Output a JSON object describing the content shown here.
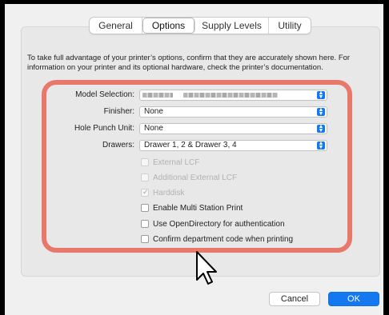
{
  "tabs": [
    {
      "label": "General"
    },
    {
      "label": "Options",
      "selected": true
    },
    {
      "label": "Supply Levels"
    },
    {
      "label": "Utility"
    }
  ],
  "intro_text": "To take full advantage of your printer’s options, confirm that they are accurately shown here. For information on your printer and its optional hardware, check the printer’s documentation.",
  "settings": {
    "model": {
      "label": "Model Selection:",
      "value": ""
    },
    "finisher": {
      "label": "Finisher:",
      "value": "None"
    },
    "hole_punch": {
      "label": "Hole Punch Unit:",
      "value": "None"
    },
    "drawers": {
      "label": "Drawers:",
      "value": "Drawer 1, 2 & Drawer 3, 4"
    }
  },
  "options": [
    {
      "label": "External LCF",
      "checked": false,
      "enabled": false
    },
    {
      "label": "Additional External LCF",
      "checked": false,
      "enabled": false
    },
    {
      "label": "Harddisk",
      "checked": true,
      "enabled": false
    },
    {
      "label": "Enable Multi Station Print",
      "checked": false,
      "enabled": true
    },
    {
      "label": "Use OpenDirectory for authentication",
      "checked": false,
      "enabled": true
    },
    {
      "label": "Confirm department code when printing",
      "checked": false,
      "enabled": true
    }
  ],
  "buttons": {
    "cancel": "Cancel",
    "ok": "OK"
  },
  "colors": {
    "accent": "#1479f0",
    "highlight": "#e8796a"
  }
}
